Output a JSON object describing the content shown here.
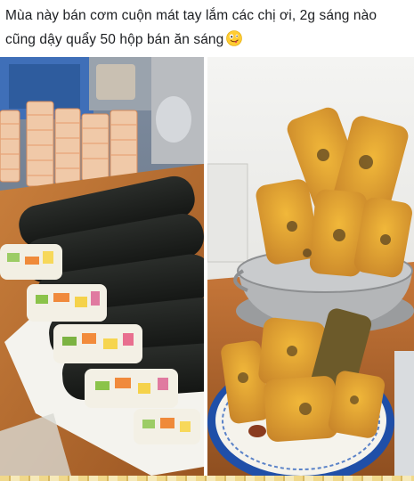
{
  "post": {
    "caption": "Mùa này bán cơm cuộn mát tay lắm các chị ơi, 2g sáng nào cũng dậy quẩy 50 hộp bán ăn sáng",
    "emoji": "zany-face-emoji"
  },
  "photos": [
    {
      "subject": "seaweed-rice-rolls"
    },
    {
      "subject": "fried-battered-rolls"
    }
  ]
}
